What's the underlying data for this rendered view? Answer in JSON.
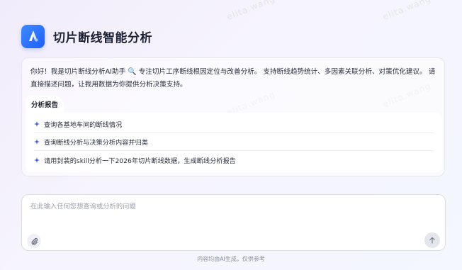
{
  "app": {
    "title": "切片断线智能分析",
    "logo_icon": "app-logo-icon"
  },
  "intro": {
    "greeting": "你好！我是切片断线分析AI助手",
    "icon": "magnifier-icon",
    "emoji": "🔍",
    "text": "专注切片工序断线根因定位与改善分析。 支持断线趋势统计、多因素关联分析、对策优化建议。 请直接描述问题，让我用数据为你提供分析决策支持。"
  },
  "report": {
    "tab_label": "分析报告",
    "suggestions": [
      {
        "label": "查询各基地车间的断线情况"
      },
      {
        "label": "查询断线分析与决策分析内容并归类"
      },
      {
        "label": "请用封装的skill分析一下2026年切片断线数据，生成断线分析报告"
      }
    ]
  },
  "input": {
    "placeholder": "在此输入任何您想查询或分析的问题",
    "value": ""
  },
  "footer": {
    "disclaimer": "内容均由AI生成，仅供参考"
  },
  "watermark": {
    "text": "elita.wang"
  },
  "colors": {
    "accent": "#2f6bff",
    "spark": "#3b5bdb"
  }
}
